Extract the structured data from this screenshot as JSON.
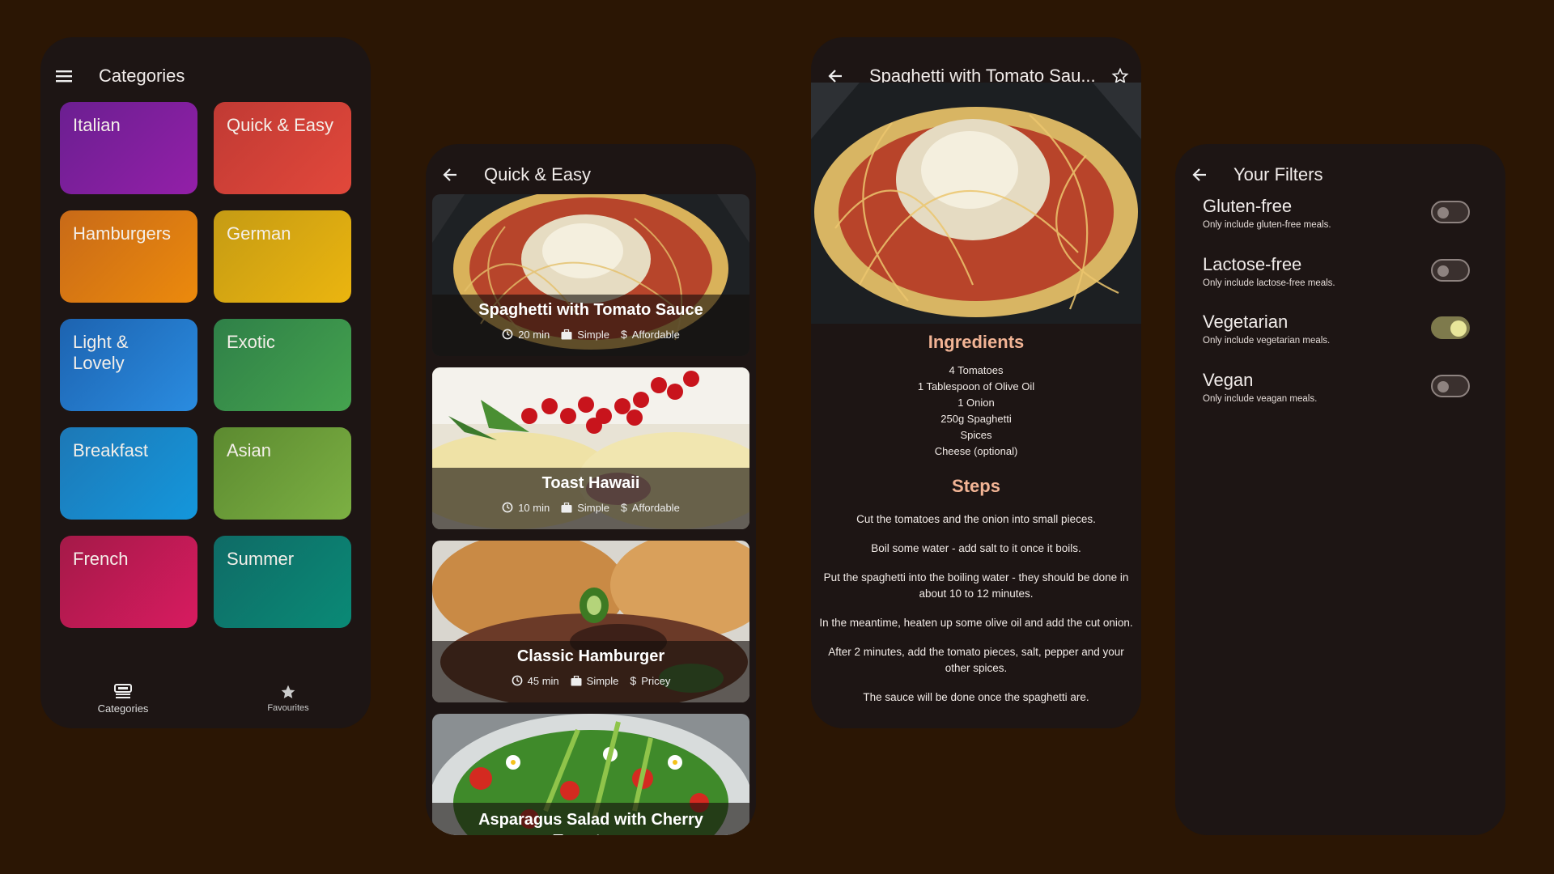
{
  "categories_screen": {
    "title": "Categories",
    "items": [
      {
        "label": "Italian",
        "color_from": "#6b1f91",
        "color_to": "#931fa8"
      },
      {
        "label": "Quick & Easy",
        "color_from": "#c03a34",
        "color_to": "#e2483b"
      },
      {
        "label": "Hamburgers",
        "color_from": "#c86a18",
        "color_to": "#ec8a0c"
      },
      {
        "label": "German",
        "color_from": "#c59b14",
        "color_to": "#ebb50f"
      },
      {
        "label": "Light & Lovely",
        "color_from": "#1d63b0",
        "color_to": "#2a8ce0"
      },
      {
        "label": "Exotic",
        "color_from": "#2f8048",
        "color_to": "#45a34e"
      },
      {
        "label": "Breakfast",
        "color_from": "#1d78b6",
        "color_to": "#1497dc"
      },
      {
        "label": "Asian",
        "color_from": "#5c8a30",
        "color_to": "#7cb043"
      },
      {
        "label": "French",
        "color_from": "#a41a48",
        "color_to": "#d81b60"
      },
      {
        "label": "Summer",
        "color_from": "#0f6b66",
        "color_to": "#0a8a76"
      }
    ],
    "nav": {
      "categories": "Categories",
      "favourites": "Favourites"
    }
  },
  "meals_screen": {
    "title": "Quick & Easy",
    "meals": [
      {
        "title": "Spaghetti with Tomato Sauce",
        "duration": "20 min",
        "complexity": "Simple",
        "affordability": "Affordable"
      },
      {
        "title": "Toast Hawaii",
        "duration": "10 min",
        "complexity": "Simple",
        "affordability": "Affordable"
      },
      {
        "title": "Classic Hamburger",
        "duration": "45 min",
        "complexity": "Simple",
        "affordability": "Pricey"
      },
      {
        "title": "Asparagus Salad with Cherry Tomatoes",
        "duration": "",
        "complexity": "",
        "affordability": ""
      }
    ]
  },
  "detail_screen": {
    "title": "Spaghetti with Tomato Sau...",
    "ingredients_heading": "Ingredients",
    "ingredients": [
      "4 Tomatoes",
      "1 Tablespoon of Olive Oil",
      "1 Onion",
      "250g Spaghetti",
      "Spices",
      "Cheese (optional)"
    ],
    "steps_heading": "Steps",
    "steps": [
      "Cut the tomatoes and the onion into small pieces.",
      "Boil some water - add salt to it once it boils.",
      "Put the spaghetti into the boiling water - they should be done in about 10 to 12 minutes.",
      "In the meantime, heaten up some olive oil and add the cut onion.",
      "After 2 minutes, add the tomato pieces, salt, pepper and your other spices.",
      "The sauce will be done once the spaghetti are."
    ]
  },
  "filters_screen": {
    "title": "Your Filters",
    "filters": [
      {
        "label": "Gluten-free",
        "desc": "Only include gluten-free meals.",
        "on": false
      },
      {
        "label": "Lactose-free",
        "desc": "Only include lactose-free meals.",
        "on": false
      },
      {
        "label": "Vegetarian",
        "desc": "Only include vegetarian meals.",
        "on": true
      },
      {
        "label": "Vegan",
        "desc": "Only include veagan meals.",
        "on": false
      }
    ]
  },
  "colors": {
    "background": "#2b1604",
    "surface": "#1d1514",
    "accent": "#f2b495"
  }
}
